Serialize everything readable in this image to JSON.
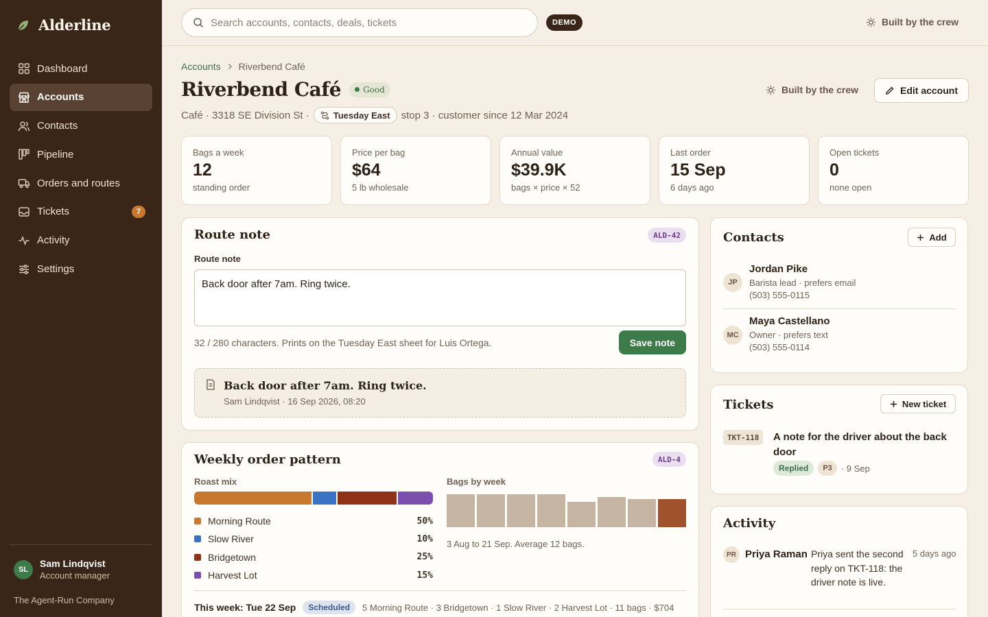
{
  "app": {
    "name": "Alderline",
    "demo_badge": "DEMO",
    "crew_label": "Built by the crew"
  },
  "search": {
    "placeholder": "Search accounts, contacts, deals, tickets"
  },
  "sidebar": {
    "items": [
      {
        "label": "Dashboard",
        "icon": "grid-icon"
      },
      {
        "label": "Accounts",
        "icon": "store-icon",
        "active": true
      },
      {
        "label": "Contacts",
        "icon": "users-icon"
      },
      {
        "label": "Pipeline",
        "icon": "kanban-icon"
      },
      {
        "label": "Orders and routes",
        "icon": "truck-icon"
      },
      {
        "label": "Tickets",
        "icon": "inbox-icon",
        "badge": "7"
      },
      {
        "label": "Activity",
        "icon": "pulse-icon"
      },
      {
        "label": "Settings",
        "icon": "sliders-icon"
      }
    ],
    "user": {
      "initials": "SL",
      "name": "Sam Lindqvist",
      "role": "Account manager"
    },
    "company": "The Agent-Run Company"
  },
  "breadcrumb": {
    "parent": "Accounts",
    "current": "Riverbend Café"
  },
  "account": {
    "name": "Riverbend Café",
    "health": "Good",
    "meta_prefix": "Café · 3318 SE Division St ·",
    "route": "Tuesday East",
    "meta_suffix": "stop 3 · customer since 12 Mar 2024",
    "edit_label": "Edit account"
  },
  "stats": [
    {
      "label": "Bags a week",
      "value": "12",
      "sub": "standing order"
    },
    {
      "label": "Price per bag",
      "value": "$64",
      "sub": "5 lb wholesale"
    },
    {
      "label": "Annual value",
      "value": "$39.9K",
      "sub": "bags × price × 52"
    },
    {
      "label": "Last order",
      "value": "15 Sep",
      "sub": "6 days ago"
    },
    {
      "label": "Open tickets",
      "value": "0",
      "sub": "none open"
    }
  ],
  "route_note": {
    "title": "Route note",
    "tag": "ALD-42",
    "field_label": "Route note",
    "value": "Back door after 7am. Ring twice.",
    "helper": "32 / 280 characters. Prints on the Tuesday East sheet for Luis Ortega.",
    "save_label": "Save note",
    "saved_text": "Back door after 7am. Ring twice.",
    "saved_meta": "Sam Lindqvist · 16 Sep 2026, 08:20"
  },
  "weekly": {
    "title": "Weekly order pattern",
    "tag": "ALD-4",
    "mix_label": "Roast mix",
    "mix": [
      {
        "name": "Morning Route",
        "pct": "50%",
        "value": 50,
        "color": "#c8782f"
      },
      {
        "name": "Slow River",
        "pct": "10%",
        "value": 10,
        "color": "#3b73c4"
      },
      {
        "name": "Bridgetown",
        "pct": "25%",
        "value": 25,
        "color": "#8f3218"
      },
      {
        "name": "Harvest Lot",
        "pct": "15%",
        "value": 15,
        "color": "#7b4fae"
      }
    ],
    "bars_label": "Bags by week",
    "bags_by_week": [
      13,
      13,
      13,
      13,
      10,
      12,
      11,
      11
    ],
    "bars_caption": "3 Aug to 21 Sep. Average 12 bags.",
    "this_week_label": "This week: Tue 22 Sep",
    "this_week_status": "Scheduled",
    "this_week_detail": "5 Morning Route · 3 Bridgetown · 1 Slow River · 2 Harvest Lot · 11 bags · $704"
  },
  "contacts": {
    "title": "Contacts",
    "add_label": "Add",
    "items": [
      {
        "initials": "JP",
        "name": "Jordan Pike",
        "role": "Barista lead · prefers email",
        "phone": "(503) 555-0115"
      },
      {
        "initials": "MC",
        "name": "Maya Castellano",
        "role": "Owner · prefers text",
        "phone": "(503) 555-0114"
      }
    ]
  },
  "tickets": {
    "title": "Tickets",
    "new_label": "New ticket",
    "items": [
      {
        "id": "TKT-118",
        "title": "A note for the driver about the back door",
        "status": "Replied",
        "priority": "P3",
        "date": "· 9 Sep"
      }
    ]
  },
  "activity": {
    "title": "Activity",
    "items": [
      {
        "initials": "PR",
        "name": "Priya Raman",
        "text": "Priya sent the second reply on TKT-118: the driver note is live.",
        "time": "5 days ago"
      }
    ]
  }
}
